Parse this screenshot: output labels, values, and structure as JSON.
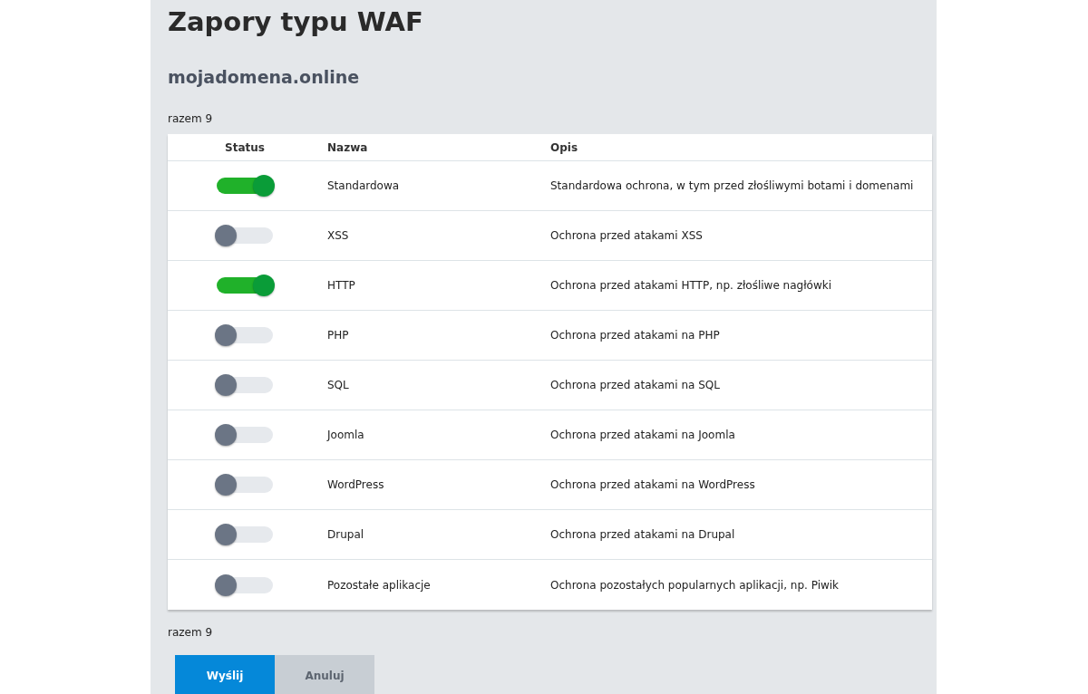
{
  "title": "Zapory typu WAF",
  "domain": "mojadomena.online",
  "count_top": "razem 9",
  "table": {
    "columns": [
      "Status",
      "Nazwa",
      "Opis"
    ],
    "rows": [
      {
        "on": true,
        "name": "Standardowa",
        "description": "Standardowa ochrona, w tym przed złośliwymi botami i domenami"
      },
      {
        "on": false,
        "name": "XSS",
        "description": "Ochrona przed atakami XSS"
      },
      {
        "on": true,
        "name": "HTTP",
        "description": "Ochrona przed atakami HTTP, np. złośliwe nagłówki"
      },
      {
        "on": false,
        "name": "PHP",
        "description": "Ochrona przed atakami na PHP"
      },
      {
        "on": false,
        "name": "SQL",
        "description": "Ochrona przed atakami na SQL"
      },
      {
        "on": false,
        "name": "Joomla",
        "description": "Ochrona przed atakami na Joomla"
      },
      {
        "on": false,
        "name": "WordPress",
        "description": "Ochrona przed atakami na WordPress"
      },
      {
        "on": false,
        "name": "Drupal",
        "description": "Ochrona przed atakami na Drupal"
      },
      {
        "on": false,
        "name": "Pozostałe aplikacje",
        "description": "Ochrona pozostałych popularnych aplikacji, np. Piwik"
      }
    ]
  },
  "count_bottom": "razem 9",
  "buttons": [
    {
      "label": "Wyślij",
      "kind": "primary"
    },
    {
      "label": "Anuluj",
      "kind": "secondary"
    }
  ]
}
